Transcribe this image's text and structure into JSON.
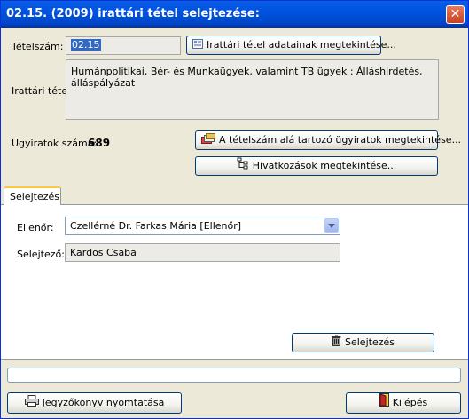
{
  "window": {
    "title": "02.15. (2009) irattári tétel selejtezése:",
    "close_label": "✕"
  },
  "item": {
    "number_label": "Tételszám:",
    "number_value": "02.15",
    "view_item_button": "Irattári tétel adatainak megtekintése...",
    "item_label": "Irattári tétel:",
    "item_value": "Humánpolitikai, Bér- és Munkaügyek, valamint TB ügyek : Álláshirdetés, álláspályázat",
    "count_label": "Ügyiratok száma:",
    "count_value": "689",
    "view_files_button": "A tételszám alá tartozó ügyiratok megtekintése...",
    "view_references_button": "Hivatkozások megtekintése..."
  },
  "tabs": [
    {
      "label": "Selejtezés",
      "active": true
    }
  ],
  "disposal": {
    "controller_label": "Ellenőr:",
    "controller_value": "Czellérné Dr. Farkas Mária [Ellenőr]",
    "disposer_label": "Selejtező:",
    "disposer_value": "Kardos Csaba",
    "dispose_button": "Selejtezés"
  },
  "progress": {
    "value": 0
  },
  "footer": {
    "print_button": "Jegyzőkönyv nyomtatása",
    "exit_button": "Kilépés"
  },
  "icons": {
    "view_item": "info-card-icon",
    "view_files": "folders-icon",
    "view_references": "hierarchy-icon",
    "dispose": "trash-bin-icon",
    "print": "printer-icon",
    "exit": "exit-door-icon"
  }
}
